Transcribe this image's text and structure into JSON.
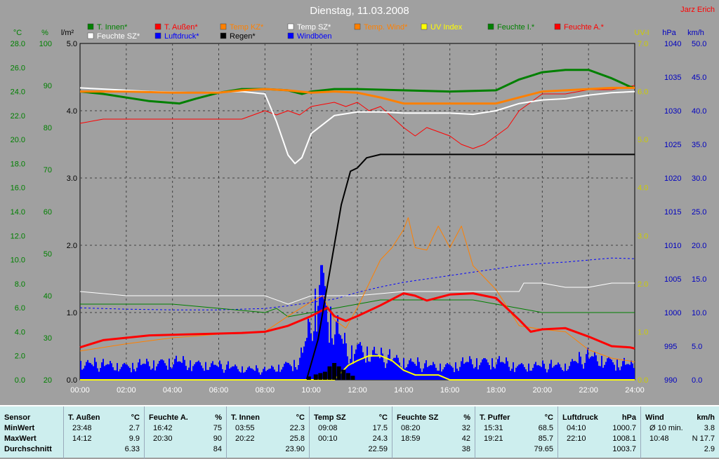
{
  "title": "Dienstag, 11.03.2008",
  "author": "Jarz Erich",
  "legend_row1": [
    {
      "label": "T. Innen*",
      "color": "#008000"
    },
    {
      "label": "T. Außen*",
      "color": "#ff0000"
    },
    {
      "label": "Temp KZ*",
      "color": "#ff8000"
    },
    {
      "label": "Temp SZ*",
      "color": "#ffffff"
    },
    {
      "label": "Temp. Wind*",
      "color": "#ff8000"
    },
    {
      "label": "UV Index",
      "color": "#ffff00"
    },
    {
      "label": "Feuchte I.*",
      "color": "#008000"
    },
    {
      "label": "Feuchte A.*",
      "color": "#ff0000"
    }
  ],
  "legend_row2": [
    {
      "label": "Feuchte SZ*",
      "color": "#ffffff"
    },
    {
      "label": "Luftdruck*",
      "color": "#0000ff"
    },
    {
      "label": "Regen*",
      "color": "#000000"
    },
    {
      "label": "Windböen",
      "color": "#0000ff"
    }
  ],
  "axes": {
    "temp": {
      "unit": "°C",
      "ticks": [
        "28.0",
        "26.0",
        "24.0",
        "22.0",
        "20.0",
        "18.0",
        "16.0",
        "14.0",
        "12.0",
        "10.0",
        "8.0",
        "6.0",
        "4.0",
        "2.0",
        "0.0"
      ],
      "color": "#008000"
    },
    "hum": {
      "unit": "%",
      "ticks": [
        "100",
        "90",
        "80",
        "70",
        "60",
        "50",
        "40",
        "30",
        "20"
      ],
      "color": "#008000"
    },
    "rain": {
      "unit": "l/m²",
      "ticks": [
        "5.0",
        "4.0",
        "3.0",
        "2.0",
        "1.0",
        "0.0"
      ],
      "color": "#000000"
    },
    "uv": {
      "unit": "UV-I",
      "ticks": [
        "7.0",
        "6.0",
        "5.0",
        "4.0",
        "3.0",
        "2.0",
        "1.0",
        "0.0"
      ],
      "color": "#cccc00"
    },
    "press": {
      "unit": "hPa",
      "ticks": [
        "1040",
        "1035",
        "1030",
        "1025",
        "1020",
        "1015",
        "1010",
        "1005",
        "1000",
        "995",
        "990"
      ],
      "color": "#0000c0"
    },
    "wind": {
      "unit": "km/h",
      "ticks": [
        "50.0",
        "45.0",
        "40.0",
        "35.0",
        "30.0",
        "25.0",
        "20.0",
        "15.0",
        "10.0",
        "5.0",
        "0.0"
      ],
      "color": "#0000c0"
    },
    "time": {
      "ticks": [
        "00:00",
        "02:00",
        "04:00",
        "06:00",
        "08:00",
        "10:00",
        "12:00",
        "14:00",
        "16:00",
        "18:00",
        "20:00",
        "22:00",
        "24:00"
      ]
    }
  },
  "chart_data": {
    "type": "line",
    "title": "Dienstag, 11.03.2008",
    "x_unit": "hours",
    "xlim": [
      0,
      24
    ],
    "series": [
      {
        "name": "T. Innen*",
        "axis": "°C",
        "color": "#008000",
        "x": [
          0,
          1,
          3,
          4.3,
          5,
          6,
          7,
          8,
          9,
          9.6,
          10,
          11,
          12,
          14,
          16,
          18,
          19,
          20,
          21,
          22,
          23,
          23.8,
          24
        ],
        "values": [
          24.0,
          23.8,
          23.2,
          23.0,
          23.4,
          23.9,
          24.2,
          24.2,
          24.1,
          23.8,
          24.0,
          24.2,
          24.2,
          24.1,
          24.0,
          24.1,
          25.0,
          25.6,
          25.8,
          25.8,
          25.1,
          24.4,
          24.3
        ]
      },
      {
        "name": "T. Außen*",
        "axis": "°C",
        "color": "#ff0000",
        "x": [
          0,
          1,
          3,
          5,
          7,
          8,
          9,
          10,
          10.7,
          11,
          11.5,
          12,
          13,
          14,
          14.5,
          15,
          16,
          17,
          18,
          19,
          19.5,
          20,
          21,
          22,
          23,
          23.8,
          24
        ],
        "values": [
          2.7,
          3.3,
          3.7,
          3.8,
          3.9,
          4.0,
          4.5,
          5.3,
          6.0,
          5.3,
          4.9,
          5.3,
          6.2,
          7.2,
          7.0,
          6.6,
          7.1,
          7.2,
          6.8,
          5.0,
          4.0,
          4.2,
          4.3,
          3.6,
          2.8,
          2.7,
          2.6
        ]
      },
      {
        "name": "Temp KZ*",
        "axis": "°C",
        "color": "#ff8000",
        "x": [
          0,
          2,
          4,
          6,
          7,
          8,
          9,
          9.5,
          10,
          11,
          12,
          13,
          14,
          14.3,
          14.6,
          15,
          15.5,
          16,
          16.5,
          17,
          18,
          19,
          20,
          21,
          22,
          23,
          24
        ],
        "values": [
          24.0,
          24.0,
          23.9,
          23.9,
          24.1,
          24.2,
          24.1,
          24.0,
          23.9,
          24.0,
          23.9,
          23.5,
          23.0,
          23.0,
          23.0,
          23.0,
          23.0,
          23.0,
          23.0,
          23.0,
          23.0,
          23.5,
          24.0,
          24.1,
          24.2,
          24.3,
          24.3
        ]
      },
      {
        "name": "Temp SZ*",
        "axis": "°C",
        "color": "#ffffff",
        "x": [
          0,
          1,
          3,
          5,
          7,
          8,
          8.5,
          9,
          9.3,
          9.6,
          10,
          11,
          12,
          13,
          14,
          15,
          16,
          17,
          18,
          19,
          20,
          21,
          22,
          23,
          24
        ],
        "values": [
          24.3,
          24.2,
          24.0,
          23.9,
          24.0,
          23.8,
          21.5,
          18.7,
          18.0,
          18.5,
          20.5,
          22.0,
          22.3,
          22.3,
          22.2,
          22.2,
          22.2,
          22.1,
          22.4,
          23.0,
          23.3,
          23.4,
          23.7,
          23.9,
          24.0
        ]
      },
      {
        "name": "Temp. Wind*",
        "axis": "°C",
        "color": "#ff8000",
        "x": [
          0,
          2,
          4,
          6,
          8,
          9,
          10,
          10.5,
          11,
          11.5,
          12,
          13,
          13.5,
          14,
          14.2,
          14.5,
          15,
          15.5,
          16,
          16.5,
          17,
          18,
          19,
          20,
          21,
          22,
          23,
          24
        ],
        "values": [
          2.4,
          3.0,
          3.5,
          3.8,
          4.0,
          5.3,
          6.5,
          7.0,
          5.0,
          4.3,
          6.0,
          10.0,
          11.0,
          12.5,
          13.5,
          11.0,
          10.8,
          12.8,
          11.0,
          12.8,
          9.5,
          7.5,
          4.5,
          4.2,
          4.0,
          2.5,
          1.8,
          1.5
        ]
      },
      {
        "name": "UV Index",
        "axis": "UV-I",
        "color": "#ffff00",
        "x": [
          0,
          11,
          11.2,
          11.6,
          12,
          12.5,
          13,
          13.5,
          14,
          14.5,
          15,
          15.5,
          16,
          16.5,
          17,
          24
        ],
        "values": [
          0,
          0,
          0.1,
          0.3,
          0.4,
          0.5,
          0.5,
          0.4,
          0.2,
          0.1,
          0.1,
          0.1,
          0,
          0,
          0,
          0
        ]
      },
      {
        "name": "Feuchte I.*",
        "axis": "%",
        "color": "#008000",
        "x": [
          0,
          2,
          4,
          6,
          8,
          8.5,
          9,
          10,
          11,
          12,
          13,
          14,
          15,
          17,
          18,
          19,
          20,
          21,
          22,
          23,
          24
        ],
        "values": [
          38,
          38,
          38,
          37,
          36,
          37,
          35,
          36,
          37,
          38,
          39,
          39,
          39,
          39,
          38,
          37,
          36,
          36,
          36,
          36,
          36
        ]
      },
      {
        "name": "Feuchte A.*",
        "axis": "%",
        "color": "#ff0000",
        "x": [
          0,
          1,
          2,
          3,
          4,
          5,
          6,
          7,
          8,
          8.5,
          9,
          9.5,
          10,
          11,
          11.5,
          12,
          12.5,
          13,
          14,
          14.5,
          15,
          15.5,
          16,
          16.5,
          17,
          17.5,
          18,
          18.5,
          19,
          19.5,
          20,
          21,
          22,
          23,
          24
        ],
        "values": [
          81,
          82,
          82,
          82,
          82,
          82,
          82,
          82,
          84,
          83,
          84,
          83,
          85,
          86,
          85,
          86,
          84,
          85,
          80,
          78,
          80,
          79,
          78,
          76,
          75,
          76,
          78,
          80,
          84,
          86,
          88,
          88,
          89,
          89,
          90
        ]
      },
      {
        "name": "Feuchte SZ*",
        "axis": "%",
        "color": "#ffffff",
        "x": [
          0,
          2,
          4,
          6,
          8,
          9,
          10,
          10.5,
          11,
          12,
          14,
          16,
          18,
          19,
          19.2,
          20,
          21,
          22,
          23,
          24
        ],
        "values": [
          41,
          40,
          40,
          40,
          40,
          38,
          40,
          40,
          40,
          40,
          41,
          41,
          41,
          41,
          43,
          43,
          42,
          42,
          43,
          43
        ]
      },
      {
        "name": "Luftdruck*",
        "axis": "hPa",
        "color": "#0000ff",
        "x": [
          0,
          2,
          4,
          6,
          8,
          9,
          10,
          11,
          12,
          13,
          14,
          15,
          16,
          17,
          18,
          19,
          20,
          21,
          22,
          23,
          24
        ],
        "values": [
          1000.7,
          1000.5,
          1000.4,
          1000.4,
          1000.6,
          1001.0,
          1001.5,
          1002.0,
          1003.0,
          1003.8,
          1004.5,
          1005.0,
          1005.5,
          1006.0,
          1006.5,
          1007.0,
          1007.3,
          1007.5,
          1007.8,
          1008.1,
          1008.0
        ]
      },
      {
        "name": "Regen*",
        "axis": "l/m²",
        "color": "#000000",
        "x": [
          0,
          9.8,
          10.3,
          10.8,
          11.3,
          11.7,
          12,
          12.4,
          13,
          24
        ],
        "values": [
          0,
          0,
          0.6,
          1.6,
          2.6,
          3.1,
          3.15,
          3.3,
          3.35,
          3.35
        ]
      }
    ]
  },
  "table": {
    "columns": [
      {
        "sensor": "T. Außen",
        "unit": "°C",
        "rows": [
          [
            "23:48",
            "2.7"
          ],
          [
            "14:12",
            "9.9"
          ],
          [
            "",
            "6.33"
          ]
        ]
      },
      {
        "sensor": "Feuchte A.",
        "unit": "%",
        "rows": [
          [
            "16:42",
            "75"
          ],
          [
            "20:30",
            "90"
          ],
          [
            "",
            "84"
          ]
        ]
      },
      {
        "sensor": "T. Innen",
        "unit": "°C",
        "rows": [
          [
            "03:55",
            "22.3"
          ],
          [
            "20:22",
            "25.8"
          ],
          [
            "",
            "23.90"
          ]
        ]
      },
      {
        "sensor": "Temp SZ",
        "unit": "°C",
        "rows": [
          [
            "09:08",
            "17.5"
          ],
          [
            "00:10",
            "24.3"
          ],
          [
            "",
            "22.59"
          ]
        ]
      },
      {
        "sensor": "Feuchte SZ",
        "unit": "%",
        "rows": [
          [
            "08:20",
            "32"
          ],
          [
            "18:59",
            "42"
          ],
          [
            "",
            "38"
          ]
        ]
      },
      {
        "sensor": "T. Puffer",
        "unit": "°C",
        "rows": [
          [
            "15:31",
            "68.5"
          ],
          [
            "19:21",
            "85.7"
          ],
          [
            "",
            "79.65"
          ]
        ]
      },
      {
        "sensor": "Luftdruck",
        "unit": "hPa",
        "rows": [
          [
            "04:10",
            "1000.7"
          ],
          [
            "22:10",
            "1008.1"
          ],
          [
            "",
            "1003.7"
          ]
        ]
      },
      {
        "sensor": "Wind",
        "unit": "km/h",
        "rows": [
          [
            "Ø 10 min.",
            "3.8"
          ],
          [
            "10:48",
            "N 17.7"
          ],
          [
            "",
            "2.9"
          ]
        ]
      }
    ],
    "row_labels": {
      "sensor": "Sensor",
      "min": "MinWert",
      "max": "MaxWert",
      "avg": "Durchschnitt"
    }
  }
}
